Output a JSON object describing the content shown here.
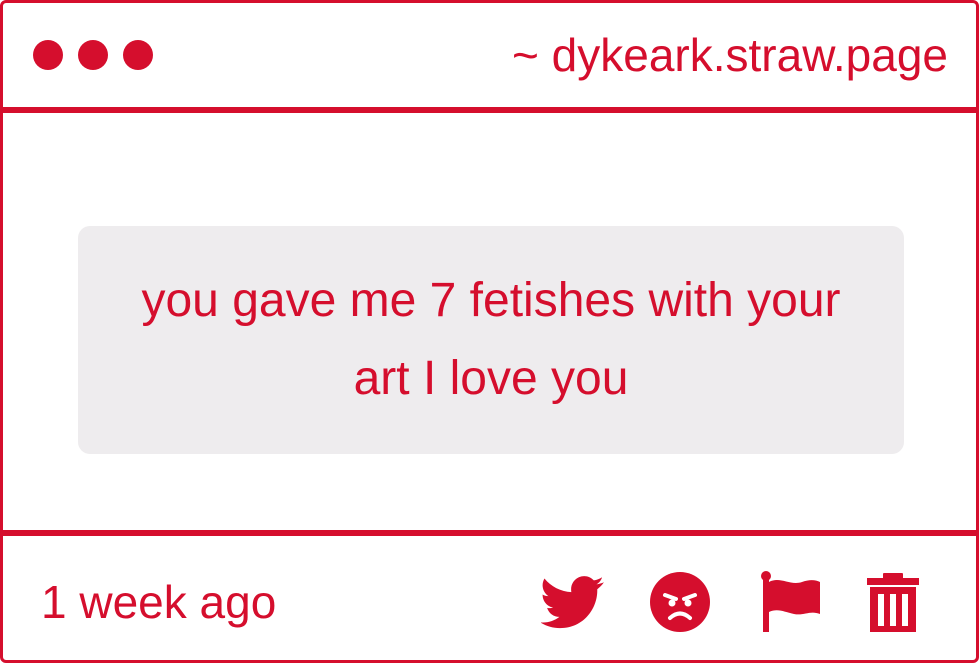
{
  "header": {
    "site_label": "~ dykeark.straw.page"
  },
  "message": {
    "text": "you gave me 7 fetishes with your art I love you"
  },
  "footer": {
    "timestamp": "1 week ago",
    "actions": [
      {
        "icon": "twitter-icon"
      },
      {
        "icon": "angry-face-icon"
      },
      {
        "icon": "flag-icon"
      },
      {
        "icon": "trash-icon"
      }
    ]
  },
  "colors": {
    "accent": "#d50e2d",
    "message_background": "#eeecee",
    "background": "#ffffff"
  }
}
